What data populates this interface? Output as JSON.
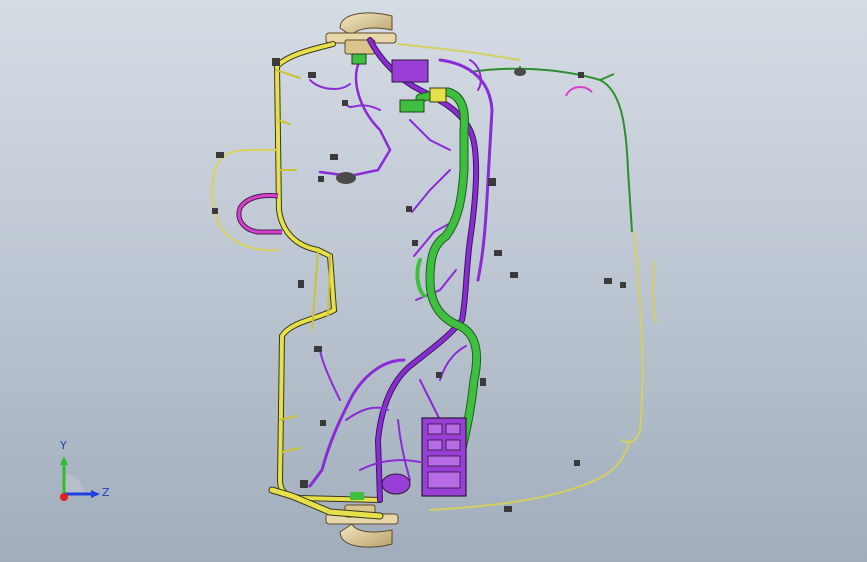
{
  "viewport": {
    "background_top": "#d6dce4",
    "background_bottom": "#a1adbb"
  },
  "model": {
    "icon": "wiring-harness-model",
    "colors": {
      "yellow_harness": "#e6e04a",
      "purple_harness": "#8a2bd6",
      "green_harness": "#3fbf3f",
      "dark_green_harness": "#2f8f2f",
      "magenta_harness": "#d63fcf",
      "beige_parts": "#e8d7a8",
      "connector_dark": "#3a3a3a"
    }
  },
  "triad": {
    "icon": "coordinate-triad-icon",
    "y_label": "Y",
    "z_label": "Z",
    "colors": {
      "y_axis": "#2fbf2f",
      "z_axis": "#1f3fdf",
      "x_axis": "#df1f1f"
    }
  }
}
